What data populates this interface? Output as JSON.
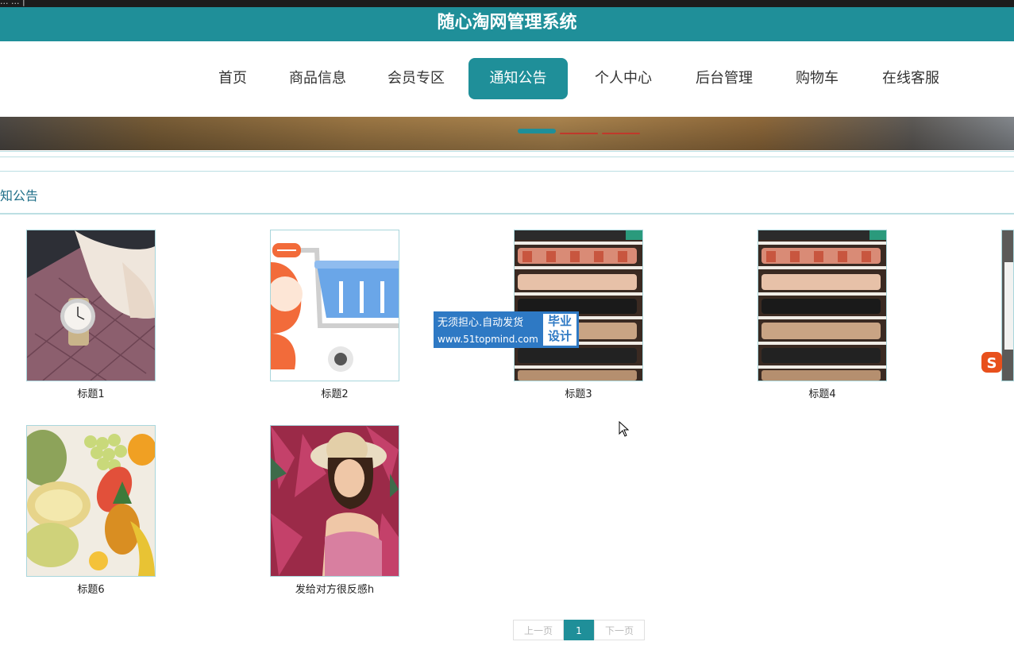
{
  "app": {
    "title": "随心淘网管理系统",
    "top_strip_text": "... ... |"
  },
  "nav": {
    "items": [
      {
        "label": "首页"
      },
      {
        "label": "商品信息"
      },
      {
        "label": "会员专区"
      },
      {
        "label": "通知公告",
        "active": true
      },
      {
        "label": "个人中心"
      },
      {
        "label": "后台管理"
      },
      {
        "label": "购物车"
      },
      {
        "label": "在线客服"
      }
    ]
  },
  "section": {
    "title": "知公告"
  },
  "notices": [
    {
      "caption": "标题1",
      "icon": "watch-photo"
    },
    {
      "caption": "标题2",
      "icon": "shopping-cart-illustration"
    },
    {
      "caption": "标题3",
      "icon": "shoe-shelf-photo"
    },
    {
      "caption": "标题4",
      "icon": "shoe-shelf-photo"
    },
    {
      "caption": "标题6",
      "icon": "fruit-photo"
    },
    {
      "caption": "发给对方很反感h",
      "icon": "woman-hat-photo"
    }
  ],
  "watermark": {
    "line1": "无须担心.自动发货",
    "line2": "www.51topmind.com",
    "badge1": "毕业",
    "badge2": "设计"
  },
  "pagination": {
    "prev": "上一页",
    "current": "1",
    "next": "下一页"
  },
  "colors": {
    "accent": "#1f8f99",
    "watermark": "#2e79c4",
    "sogou": "#e8501c"
  }
}
